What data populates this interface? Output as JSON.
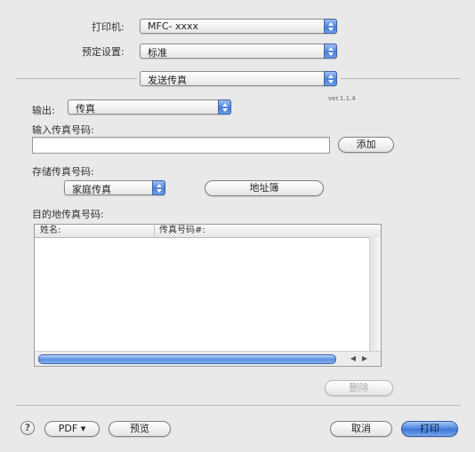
{
  "printer": {
    "label": "打印机:",
    "value": "MFC- xxxx"
  },
  "presets": {
    "label": "预定设置:",
    "value": "标准"
  },
  "pane": {
    "value": "发送传真"
  },
  "version": "ver.1.1.4",
  "output": {
    "label": "输出:",
    "value": "传真"
  },
  "fax_input": {
    "label": "输入传真号码:",
    "value": "",
    "add_button": "添加"
  },
  "stored": {
    "label": "存储传真号码:",
    "value": "家庭传真",
    "address_book_button": "地址簿"
  },
  "destination": {
    "label": "目的地传真号码:",
    "columns": [
      "姓名:",
      "传真号码#:"
    ],
    "rows": []
  },
  "delete_button": "删除",
  "footer": {
    "help": "?",
    "pdf_button": "PDF ▾",
    "preview_button": "预览",
    "cancel_button": "取消",
    "print_button": "打印"
  },
  "colors": {
    "accent": "#4a7fd8",
    "background": "#e9e9e9"
  }
}
